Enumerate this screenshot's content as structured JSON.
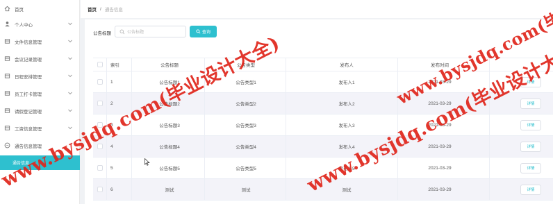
{
  "sidebar": {
    "items": [
      {
        "label": "首页",
        "icon": "home-icon"
      },
      {
        "label": "个人中心",
        "icon": "user-icon"
      },
      {
        "label": "文件信息管理",
        "icon": "list-icon"
      },
      {
        "label": "会议记录管理",
        "icon": "list-icon"
      },
      {
        "label": "日程安排管理",
        "icon": "list-icon"
      },
      {
        "label": "员工打卡管理",
        "icon": "list-icon"
      },
      {
        "label": "请假登记管理",
        "icon": "list-icon"
      },
      {
        "label": "工资信息管理",
        "icon": "list-icon"
      },
      {
        "label": "通告信息管理",
        "icon": "info-icon"
      }
    ],
    "sub_active": "通告信息"
  },
  "breadcrumb": {
    "home": "首页",
    "separator": "/",
    "current": "通告信息"
  },
  "search": {
    "label": "公告标题",
    "placeholder": "公告标题",
    "button": "查询"
  },
  "table": {
    "headers": [
      "索引",
      "公告标题",
      "公告类型",
      "发布人",
      "发布时间"
    ],
    "rows": [
      {
        "index": "1",
        "title": "公告标题1",
        "type": "公告类型1",
        "publisher": "发布人1",
        "time": "2021-03-29",
        "action": "详情"
      },
      {
        "index": "2",
        "title": "公告标题2",
        "type": "公告类型2",
        "publisher": "发布人2",
        "time": "2021-03-29",
        "action": "详情"
      },
      {
        "index": "3",
        "title": "公告标题3",
        "type": "公告类型3",
        "publisher": "发布人3",
        "time": "2021-03-29",
        "action": "详情"
      },
      {
        "index": "4",
        "title": "公告标题4",
        "type": "公告类型4",
        "publisher": "发布人4",
        "time": "2021-03-29",
        "action": "详情"
      },
      {
        "index": "5",
        "title": "公告标题5",
        "type": "公告类型5",
        "publisher": "发布人5",
        "time": "2021-03-29",
        "action": "详情"
      },
      {
        "index": "6",
        "title": "测试",
        "type": "测试",
        "publisher": "测试",
        "time": "2021-03-29",
        "action": "详情"
      }
    ]
  },
  "watermarks": {
    "text_a": "www.bysjdq.com(毕业设计大全)",
    "text_b": "www.bysjdq.com(毕业设计大全)",
    "text_c": "www.bysjdq.com(毕业设计大全)",
    "color": "#e0251b"
  },
  "colors": {
    "accent": "#2ec0cf"
  }
}
